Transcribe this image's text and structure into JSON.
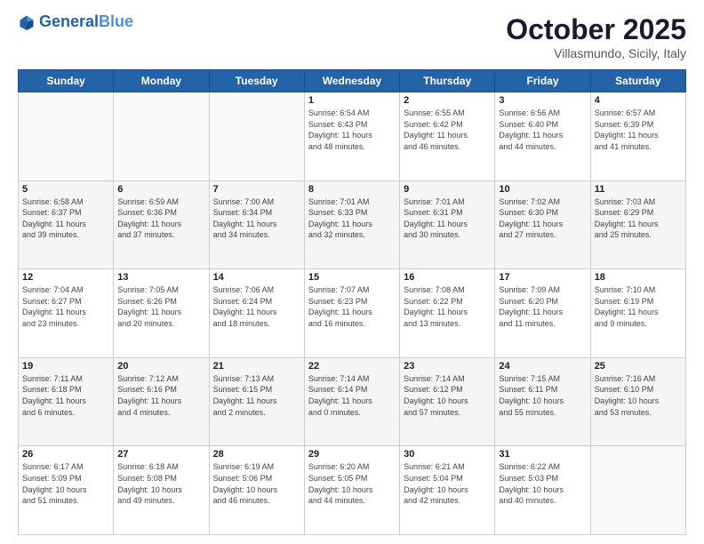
{
  "header": {
    "logo_line1": "General",
    "logo_line2": "Blue",
    "month": "October 2025",
    "location": "Villasmundo, Sicily, Italy"
  },
  "days_of_week": [
    "Sunday",
    "Monday",
    "Tuesday",
    "Wednesday",
    "Thursday",
    "Friday",
    "Saturday"
  ],
  "weeks": [
    [
      {
        "day": "",
        "info": ""
      },
      {
        "day": "",
        "info": ""
      },
      {
        "day": "",
        "info": ""
      },
      {
        "day": "1",
        "info": "Sunrise: 6:54 AM\nSunset: 6:43 PM\nDaylight: 11 hours\nand 48 minutes."
      },
      {
        "day": "2",
        "info": "Sunrise: 6:55 AM\nSunset: 6:42 PM\nDaylight: 11 hours\nand 46 minutes."
      },
      {
        "day": "3",
        "info": "Sunrise: 6:56 AM\nSunset: 6:40 PM\nDaylight: 11 hours\nand 44 minutes."
      },
      {
        "day": "4",
        "info": "Sunrise: 6:57 AM\nSunset: 6:39 PM\nDaylight: 11 hours\nand 41 minutes."
      }
    ],
    [
      {
        "day": "5",
        "info": "Sunrise: 6:58 AM\nSunset: 6:37 PM\nDaylight: 11 hours\nand 39 minutes."
      },
      {
        "day": "6",
        "info": "Sunrise: 6:59 AM\nSunset: 6:36 PM\nDaylight: 11 hours\nand 37 minutes."
      },
      {
        "day": "7",
        "info": "Sunrise: 7:00 AM\nSunset: 6:34 PM\nDaylight: 11 hours\nand 34 minutes."
      },
      {
        "day": "8",
        "info": "Sunrise: 7:01 AM\nSunset: 6:33 PM\nDaylight: 11 hours\nand 32 minutes."
      },
      {
        "day": "9",
        "info": "Sunrise: 7:01 AM\nSunset: 6:31 PM\nDaylight: 11 hours\nand 30 minutes."
      },
      {
        "day": "10",
        "info": "Sunrise: 7:02 AM\nSunset: 6:30 PM\nDaylight: 11 hours\nand 27 minutes."
      },
      {
        "day": "11",
        "info": "Sunrise: 7:03 AM\nSunset: 6:29 PM\nDaylight: 11 hours\nand 25 minutes."
      }
    ],
    [
      {
        "day": "12",
        "info": "Sunrise: 7:04 AM\nSunset: 6:27 PM\nDaylight: 11 hours\nand 23 minutes."
      },
      {
        "day": "13",
        "info": "Sunrise: 7:05 AM\nSunset: 6:26 PM\nDaylight: 11 hours\nand 20 minutes."
      },
      {
        "day": "14",
        "info": "Sunrise: 7:06 AM\nSunset: 6:24 PM\nDaylight: 11 hours\nand 18 minutes."
      },
      {
        "day": "15",
        "info": "Sunrise: 7:07 AM\nSunset: 6:23 PM\nDaylight: 11 hours\nand 16 minutes."
      },
      {
        "day": "16",
        "info": "Sunrise: 7:08 AM\nSunset: 6:22 PM\nDaylight: 11 hours\nand 13 minutes."
      },
      {
        "day": "17",
        "info": "Sunrise: 7:09 AM\nSunset: 6:20 PM\nDaylight: 11 hours\nand 11 minutes."
      },
      {
        "day": "18",
        "info": "Sunrise: 7:10 AM\nSunset: 6:19 PM\nDaylight: 11 hours\nand 9 minutes."
      }
    ],
    [
      {
        "day": "19",
        "info": "Sunrise: 7:11 AM\nSunset: 6:18 PM\nDaylight: 11 hours\nand 6 minutes."
      },
      {
        "day": "20",
        "info": "Sunrise: 7:12 AM\nSunset: 6:16 PM\nDaylight: 11 hours\nand 4 minutes."
      },
      {
        "day": "21",
        "info": "Sunrise: 7:13 AM\nSunset: 6:15 PM\nDaylight: 11 hours\nand 2 minutes."
      },
      {
        "day": "22",
        "info": "Sunrise: 7:14 AM\nSunset: 6:14 PM\nDaylight: 11 hours\nand 0 minutes."
      },
      {
        "day": "23",
        "info": "Sunrise: 7:14 AM\nSunset: 6:12 PM\nDaylight: 10 hours\nand 57 minutes."
      },
      {
        "day": "24",
        "info": "Sunrise: 7:15 AM\nSunset: 6:11 PM\nDaylight: 10 hours\nand 55 minutes."
      },
      {
        "day": "25",
        "info": "Sunrise: 7:16 AM\nSunset: 6:10 PM\nDaylight: 10 hours\nand 53 minutes."
      }
    ],
    [
      {
        "day": "26",
        "info": "Sunrise: 6:17 AM\nSunset: 5:09 PM\nDaylight: 10 hours\nand 51 minutes."
      },
      {
        "day": "27",
        "info": "Sunrise: 6:18 AM\nSunset: 5:08 PM\nDaylight: 10 hours\nand 49 minutes."
      },
      {
        "day": "28",
        "info": "Sunrise: 6:19 AM\nSunset: 5:06 PM\nDaylight: 10 hours\nand 46 minutes."
      },
      {
        "day": "29",
        "info": "Sunrise: 6:20 AM\nSunset: 5:05 PM\nDaylight: 10 hours\nand 44 minutes."
      },
      {
        "day": "30",
        "info": "Sunrise: 6:21 AM\nSunset: 5:04 PM\nDaylight: 10 hours\nand 42 minutes."
      },
      {
        "day": "31",
        "info": "Sunrise: 6:22 AM\nSunset: 5:03 PM\nDaylight: 10 hours\nand 40 minutes."
      },
      {
        "day": "",
        "info": ""
      }
    ]
  ]
}
